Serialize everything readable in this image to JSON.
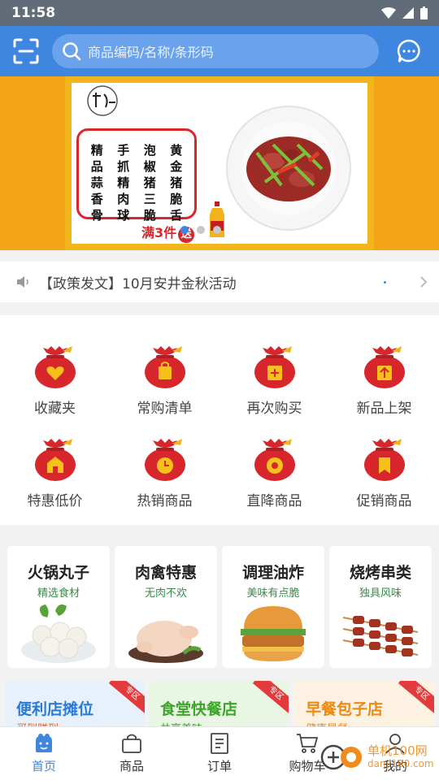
{
  "status_bar": {
    "time": "11:58"
  },
  "topbar": {
    "search_placeholder": "商品编码/名称/条形码"
  },
  "banner": {
    "menu_columns": [
      [
        "精",
        "品",
        "蒜",
        "香",
        "骨"
      ],
      [
        "手",
        "抓",
        "精",
        "肉",
        "球"
      ],
      [
        "泡",
        "椒",
        "猪",
        "三",
        "脆"
      ],
      [
        "黄",
        "金",
        "猪",
        "脆",
        "舌"
      ]
    ],
    "promo_text": "满3件",
    "promo_badge": "送"
  },
  "notice": {
    "text": "【政策发文】10月安井金秋活动"
  },
  "grid": [
    {
      "label": "收藏夹",
      "icon": "heart-icon"
    },
    {
      "label": "常购清单",
      "icon": "bag-icon"
    },
    {
      "label": "再次购买",
      "icon": "plus-box-icon"
    },
    {
      "label": "新品上架",
      "icon": "upload-icon"
    },
    {
      "label": "特惠低价",
      "icon": "store-icon"
    },
    {
      "label": "热销商品",
      "icon": "clock-icon"
    },
    {
      "label": "直降商品",
      "icon": "gear-icon"
    },
    {
      "label": "促销商品",
      "icon": "bookmark-icon"
    }
  ],
  "categories": [
    {
      "title": "火锅丸子",
      "subtitle": "精选食材"
    },
    {
      "title": "肉禽特惠",
      "subtitle": "无肉不欢"
    },
    {
      "title": "调理油炸",
      "subtitle": "美味有点脆"
    },
    {
      "title": "烧烤串类",
      "subtitle": "独具风味"
    }
  ],
  "zones": [
    {
      "title": "便利店摊位",
      "subtitle": "买到赚到",
      "tag": "专区"
    },
    {
      "title": "食堂快餐店",
      "subtitle": "共享美味",
      "tag": "专区"
    },
    {
      "title": "早餐包子店",
      "subtitle": "健康早餐",
      "tag": "专区"
    }
  ],
  "nav": [
    {
      "label": "首页"
    },
    {
      "label": "商品"
    },
    {
      "label": "订单"
    },
    {
      "label": "购物车"
    },
    {
      "label": "我的"
    }
  ],
  "watermark": {
    "line1": "单机100网",
    "line2": "danji100.com"
  },
  "colors": {
    "primary": "#3f86e0",
    "red": "#d7272d",
    "banner_orange": "#f4a417"
  }
}
